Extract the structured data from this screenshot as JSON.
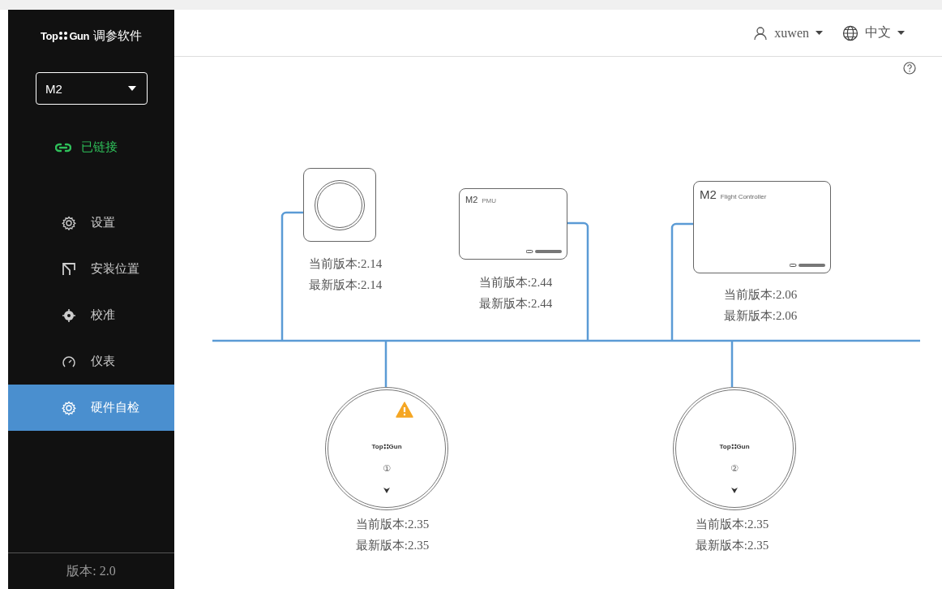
{
  "app": {
    "brand_left": "Top",
    "brand_right": "Gun",
    "title": "调参软件"
  },
  "device_select": {
    "value": "M2"
  },
  "connection": {
    "label": "已链接",
    "connected": true
  },
  "nav": [
    {
      "label": "设置",
      "kind": "gear",
      "selected": false
    },
    {
      "label": "安装位置",
      "kind": "mount",
      "selected": false
    },
    {
      "label": "校准",
      "kind": "target",
      "selected": false
    },
    {
      "label": "仪表",
      "kind": "gauge",
      "selected": false
    },
    {
      "label": "硬件自检",
      "kind": "gear",
      "selected": true
    }
  ],
  "version": "版本: 2.0",
  "header": {
    "user": "xuwen",
    "language": "中文"
  },
  "devices": [
    {
      "kind": "gps",
      "current": "当前版本:2.14",
      "latest": "最新版本:2.14"
    },
    {
      "kind": "pmu",
      "model": "M2",
      "name": "PMU",
      "current": "当前版本:2.44",
      "latest": "最新版本:2.44"
    },
    {
      "kind": "fc",
      "model": "M2",
      "name": "Flight Controller",
      "current": "当前版本:2.06",
      "latest": "最新版本:2.06"
    },
    {
      "kind": "motor",
      "brand_left": "Top",
      "brand_right": "Gun",
      "index": "①",
      "warning": true,
      "current": "当前版本:2.35",
      "latest": "最新版本:2.35"
    },
    {
      "kind": "motor",
      "brand_left": "Top",
      "brand_right": "Gun",
      "index": "②",
      "warning": false,
      "current": "当前版本:2.35",
      "latest": "最新版本:2.35"
    }
  ]
}
